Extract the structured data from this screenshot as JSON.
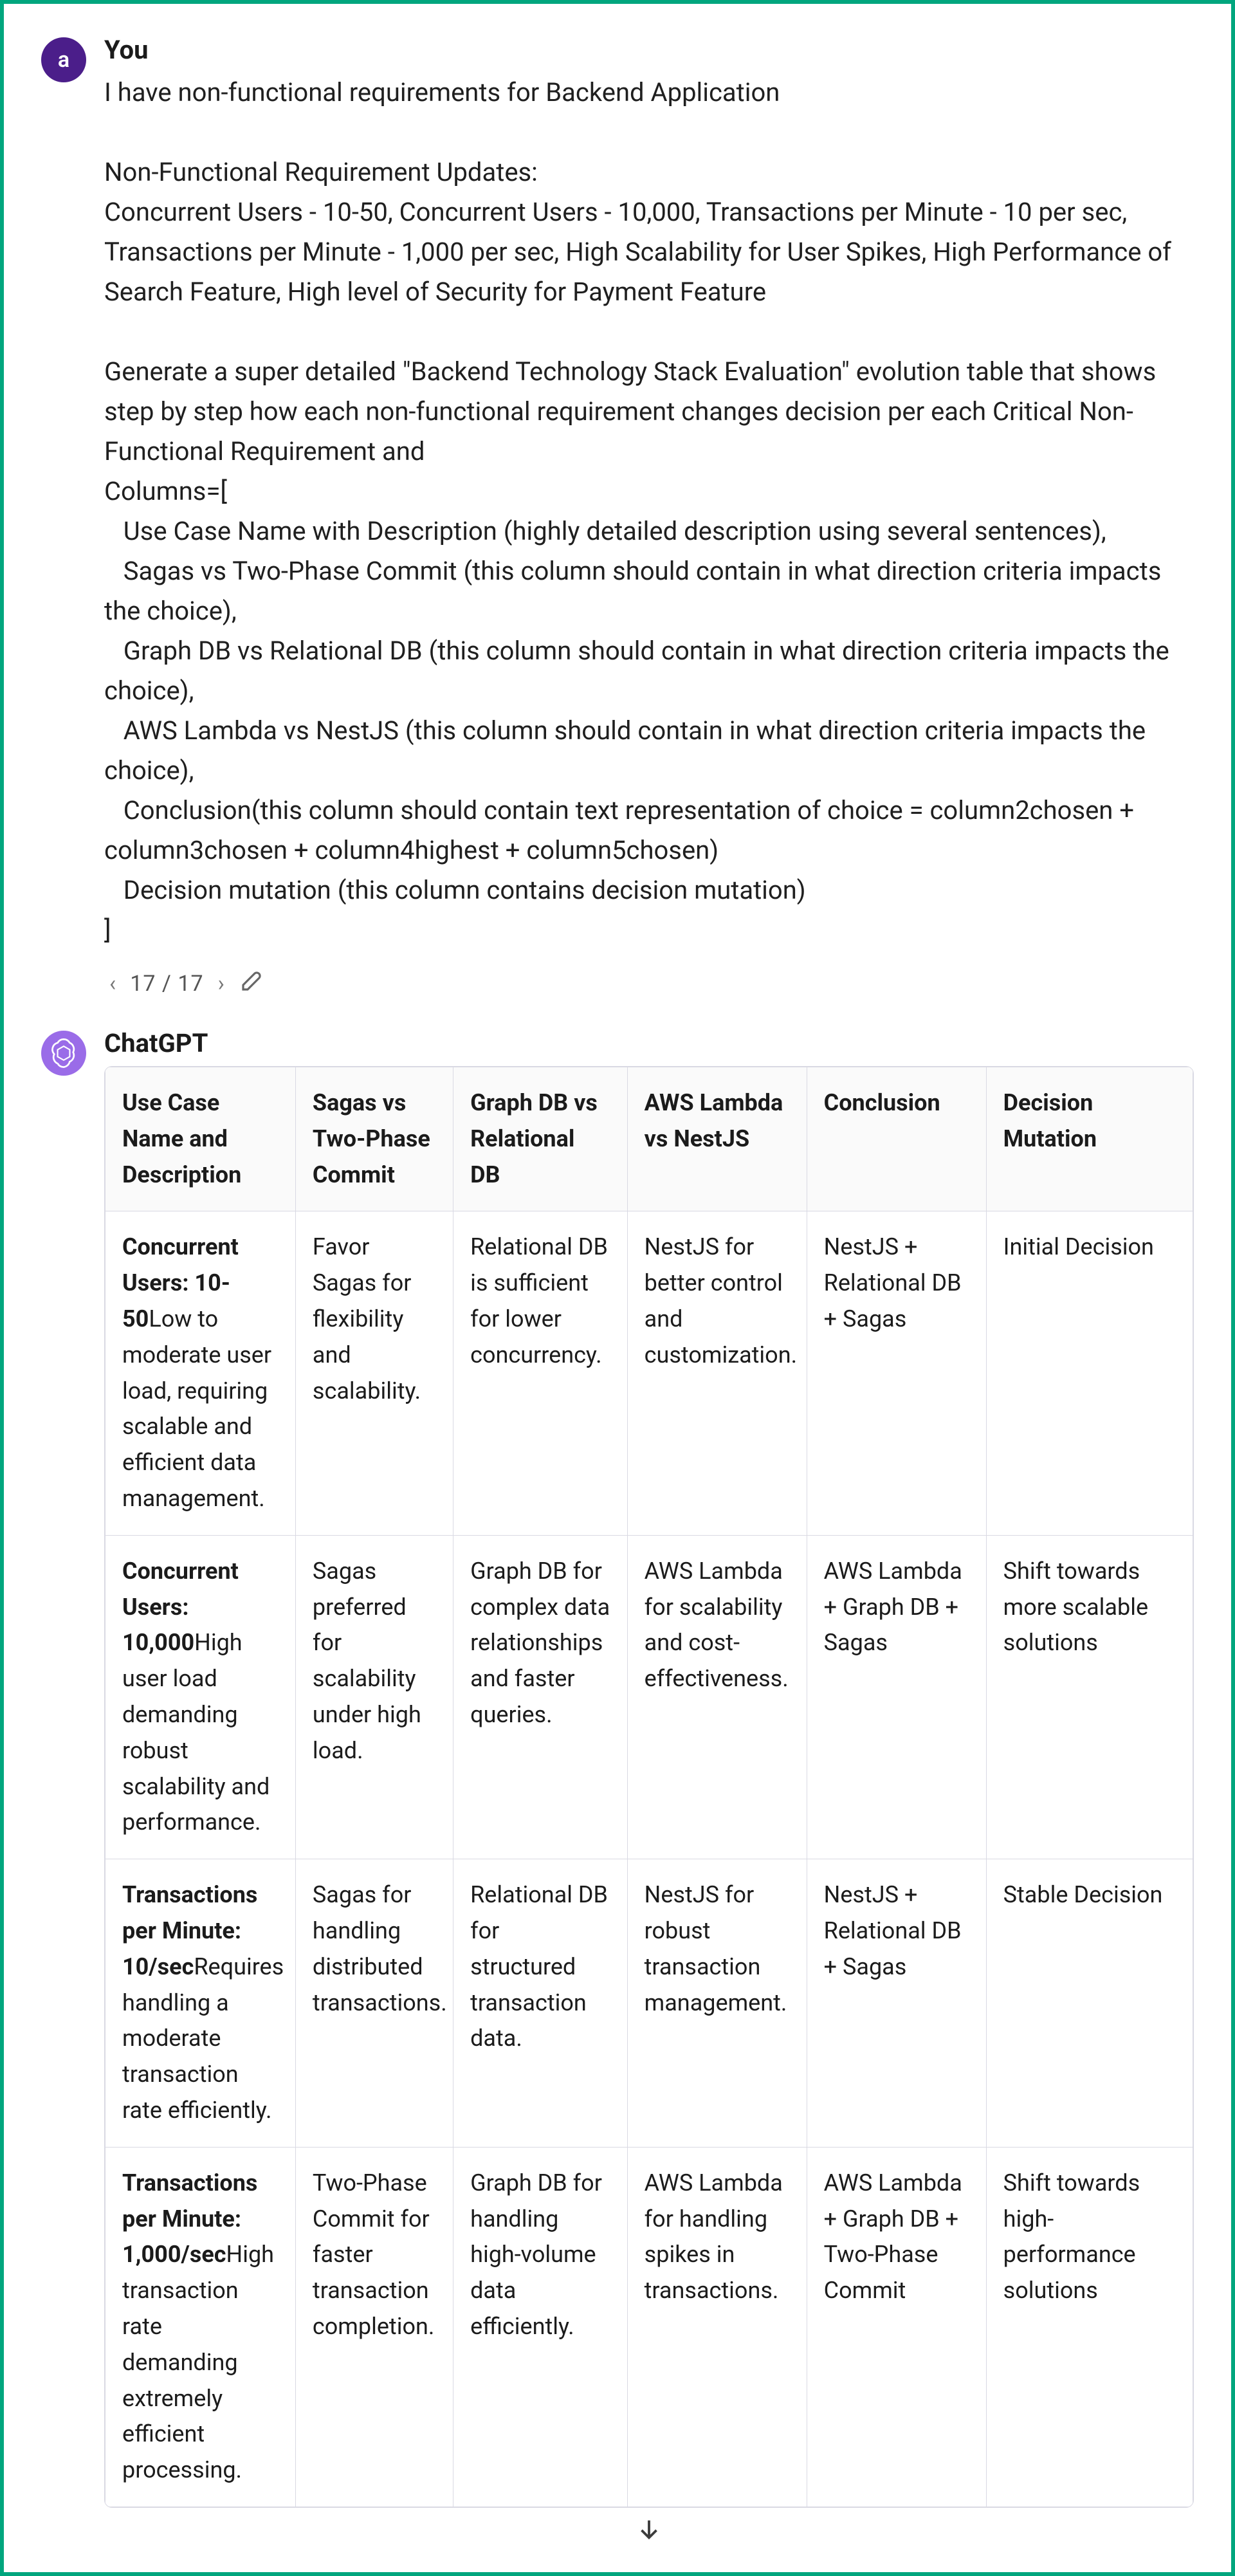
{
  "user": {
    "name": "You",
    "avatar_letter": "a",
    "message": "I have non-functional requirements for Backend Application\n\nNon-Functional Requirement Updates:\nConcurrent Users - 10-50, Concurrent Users - 10,000, Transactions per Minute - 10 per sec, Transactions per Minute - 1,000 per sec, High Scalability for User Spikes, High Performance of Search Feature, High level of Security for Payment Feature\n\nGenerate a super detailed \"Backend Technology Stack Evaluation\" evolution table that shows step by step how each non-functional requirement changes decision per each Critical Non-Functional Requirement and\nColumns=[\n   Use Case Name with Description (highly detailed description using several sentences),\n   Sagas vs Two-Phase Commit (this column should contain in what direction criteria impacts the choice),\n   Graph DB vs Relational DB (this column should contain in what direction criteria impacts the choice),\n   AWS Lambda vs NestJS (this column should contain in what direction criteria impacts the choice),\n   Conclusion(this column should contain text representation of choice = column2chosen + column3chosen + column4highest + column5chosen)\n   Decision mutation (this column contains decision mutation)\n]"
  },
  "pager": {
    "prev": "‹",
    "count": "17 / 17",
    "next": "›"
  },
  "assistant": {
    "name": "ChatGPT"
  },
  "table": {
    "headers": [
      "Use Case Name and Description",
      "Sagas vs Two-Phase Commit",
      "Graph DB vs Relational DB",
      "AWS Lambda vs NestJS",
      "Conclusion",
      "Decision Mutation"
    ],
    "rows": [
      {
        "title": "Concurrent Users: 10-50",
        "desc": "Low to moderate user load, requiring scalable and efficient data management.",
        "c1": "Favor Sagas for flexibility and scalability.",
        "c2": "Relational DB is sufficient for lower concurrency.",
        "c3": "NestJS for better control and customization.",
        "c4": "NestJS + Relational DB + Sagas",
        "c5": "Initial Decision"
      },
      {
        "title": "Concurrent Users: 10,000",
        "desc": "High user load demanding robust scalability and performance.",
        "c1": "Sagas preferred for scalability under high load.",
        "c2": "Graph DB for complex data relationships and faster queries.",
        "c3": "AWS Lambda for scalability and cost-effectiveness.",
        "c4": "AWS Lambda + Graph DB + Sagas",
        "c5": "Shift towards more scalable solutions"
      },
      {
        "title": "Transactions per Minute: 10/sec",
        "desc": "Requires handling a moderate transaction rate efficiently.",
        "c1": "Sagas for handling distributed transactions.",
        "c2": "Relational DB for structured transaction data.",
        "c3": "NestJS for robust transaction management.",
        "c4": "NestJS + Relational DB + Sagas",
        "c5": "Stable Decision"
      },
      {
        "title": "Transactions per Minute: 1,000/sec",
        "desc": "High transaction rate demanding extremely efficient processing.",
        "c1": "Two-Phase Commit for faster transaction completion.",
        "c2": "Graph DB for handling high-volume data efficiently.",
        "c3": "AWS Lambda for handling spikes in transactions.",
        "c4": "AWS Lambda + Graph DB + Two-Phase Commit",
        "c5": "Shift towards high-performance solutions"
      }
    ]
  }
}
